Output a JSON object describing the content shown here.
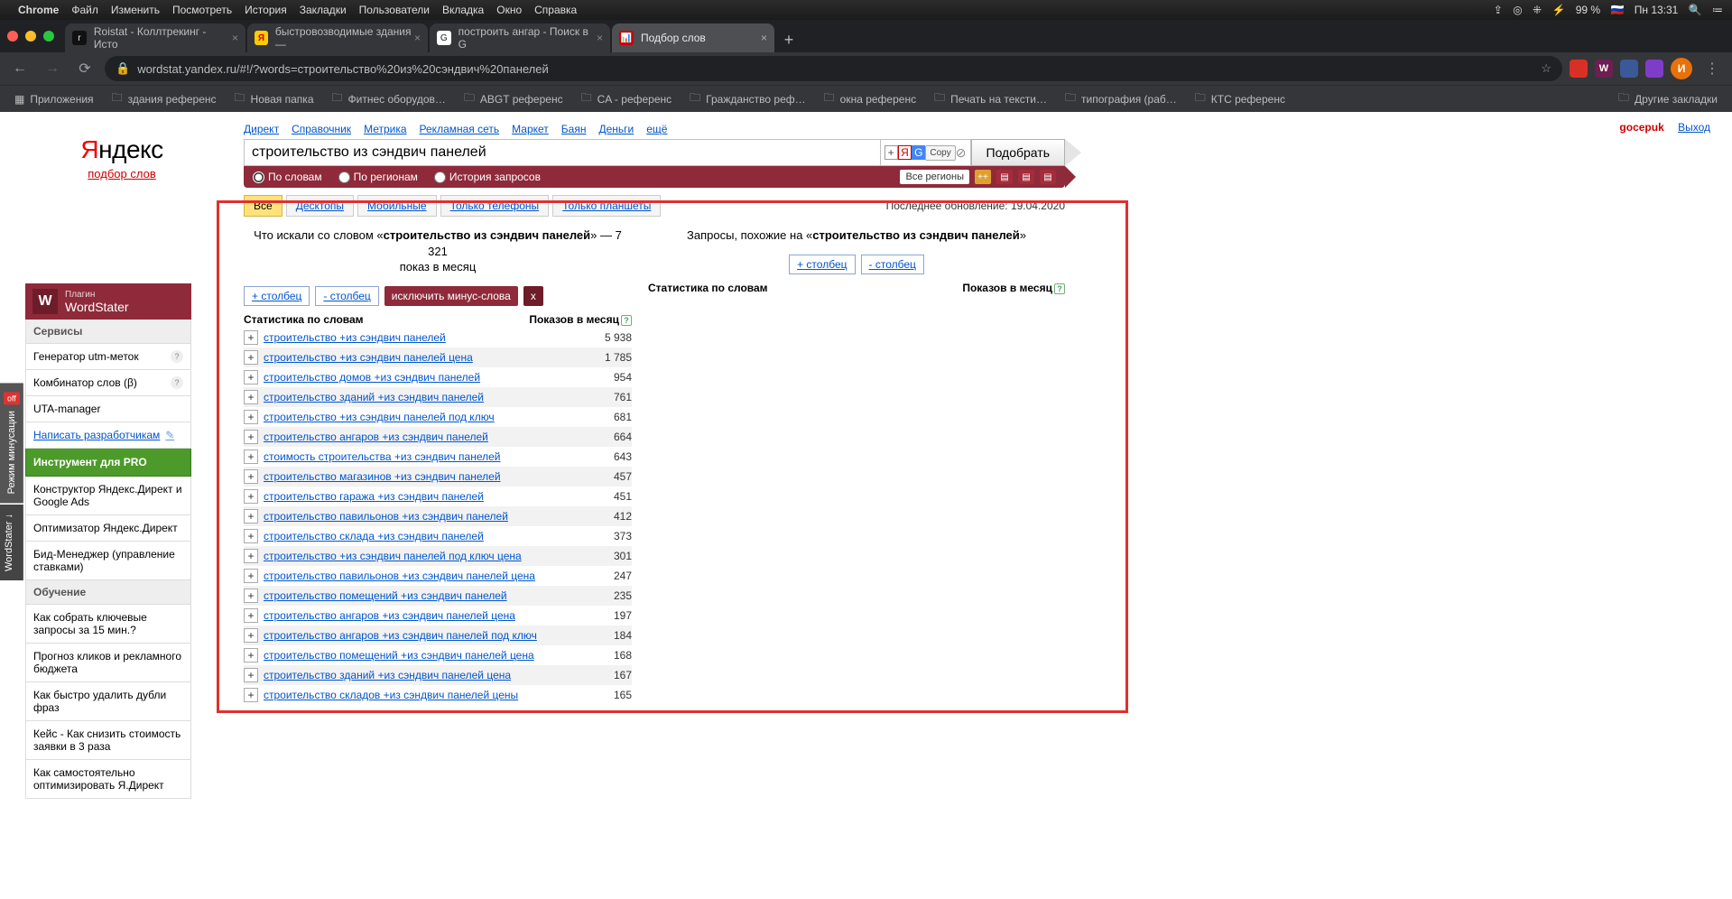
{
  "mac": {
    "app": "Chrome",
    "menus": [
      "Файл",
      "Изменить",
      "Посмотреть",
      "История",
      "Закладки",
      "Пользователи",
      "Вкладка",
      "Окно",
      "Справка"
    ],
    "right": {
      "battery": "99 %",
      "time": "Пн 13:31"
    }
  },
  "tabs": [
    {
      "fav": "r",
      "text": "Roistat - Коллтрекинг - Исто"
    },
    {
      "fav": "y",
      "text": "быстровозводимые здания —"
    },
    {
      "fav": "g",
      "text": "построить ангар - Поиск в G"
    },
    {
      "fav": "red",
      "text": "Подбор слов",
      "active": true
    }
  ],
  "url": "wordstat.yandex.ru/#!/?words=строительство%20из%20сэндвич%20панелей",
  "bookmarks": [
    "Приложения",
    "здания референс",
    "Новая папка",
    "Фитнес оборудов…",
    "ABGT референс",
    "CA - референс",
    "Гражданство реф…",
    "окна референс",
    "Печать на тексти…",
    "типография (раб…",
    "КТС референс"
  ],
  "bookmarks_other": "Другие закладки",
  "topnav": [
    "Директ",
    "Справочник",
    "Метрика",
    "Рекламная сеть",
    "Маркет",
    "Баян",
    "Деньги",
    "ещё"
  ],
  "logo": {
    "brand_ya": "Я",
    "brand_rest": "ндекс",
    "sub": "подбор слов"
  },
  "search": {
    "value": "строительство из сэндвич панелей",
    "submit": "Подобрать",
    "copy": "Copy"
  },
  "maroon": {
    "opt1": "По словам",
    "opt2": "По регионам",
    "opt3": "История запросов",
    "regions": "Все регионы"
  },
  "user": {
    "name": "gocepuk",
    "logout": "Выход"
  },
  "device_tabs": [
    "Все",
    "Десктопы",
    "Мобильные",
    "Только телефоны",
    "Только планшеты"
  ],
  "update": "Последнее обновление: 19.04.2020",
  "left_col": {
    "title_pre": "Что искали со словом «",
    "phrase": "строительство из сэндвич панелей",
    "title_post": "» — ",
    "count": "7 321",
    "title_tail": " показ в месяц",
    "plus": "+ столбец",
    "minus": "- столбец",
    "chip": "исключить минус-слова",
    "x": "x",
    "head_l": "Статистика по словам",
    "head_r": "Показов в месяц"
  },
  "right_col": {
    "title_pre": "Запросы, похожие на «",
    "phrase": "строительство из сэндвич панелей",
    "title_post": "»",
    "plus": "+ столбец",
    "minus": "- столбец",
    "head_l": "Статистика по словам",
    "head_r": "Показов в месяц"
  },
  "keywords": [
    {
      "t": "строительство +из сэндвич панелей",
      "n": "5 938"
    },
    {
      "t": "строительство +из сэндвич панелей цена",
      "n": "1 785"
    },
    {
      "t": "строительство домов +из сэндвич панелей",
      "n": "954"
    },
    {
      "t": "строительство зданий +из сэндвич панелей",
      "n": "761"
    },
    {
      "t": "строительство +из сэндвич панелей под ключ",
      "n": "681"
    },
    {
      "t": "строительство ангаров +из сэндвич панелей",
      "n": "664"
    },
    {
      "t": "стоимость строительства +из сэндвич панелей",
      "n": "643"
    },
    {
      "t": "строительство магазинов +из сэндвич панелей",
      "n": "457"
    },
    {
      "t": "строительство гаража +из сэндвич панелей",
      "n": "451"
    },
    {
      "t": "строительство павильонов +из сэндвич панелей",
      "n": "412"
    },
    {
      "t": "строительство склада +из сэндвич панелей",
      "n": "373"
    },
    {
      "t": "строительство +из сэндвич панелей под ключ цена",
      "n": "301"
    },
    {
      "t": "строительство павильонов +из сэндвич панелей цена",
      "n": "247"
    },
    {
      "t": "строительство помещений +из сэндвич панелей",
      "n": "235"
    },
    {
      "t": "строительство ангаров +из сэндвич панелей цена",
      "n": "197"
    },
    {
      "t": "строительство ангаров +из сэндвич панелей под ключ",
      "n": "184"
    },
    {
      "t": "строительство помещений +из сэндвич панелей цена",
      "n": "168"
    },
    {
      "t": "строительство зданий +из сэндвич панелей цена",
      "n": "167"
    },
    {
      "t": "строительство складов +из сэндвич панелей цены",
      "n": "165"
    }
  ],
  "sidebar": {
    "badge": "W",
    "pre": "Плагин",
    "name": "WordStater",
    "s1": "Сервисы",
    "items1": [
      "Генератор utm-меток",
      "Комбинатор слов (β)",
      "UTA-manager"
    ],
    "write": "Написать разработчикам",
    "green": "Инструмент для PRO",
    "items2": [
      "Конструктор Яндекс.Директ и Google Ads",
      "Оптимизатор Яндекс.Директ",
      "Бид-Менеджер (управление ставками)"
    ],
    "s2": "Обучение",
    "items3": [
      "Как собрать ключевые запросы за 15 мин.?",
      "Прогноз кликов и рекламного бюджета",
      "Как быстро удалить дубли фраз",
      "Кейс - Как снизить стоимость заявки в 3 раза",
      "Как самостоятельно оптимизировать Я.Директ"
    ]
  },
  "sidetabs": {
    "a": "Режим минусации",
    "b": "WordStater ↓",
    "off": "off"
  }
}
